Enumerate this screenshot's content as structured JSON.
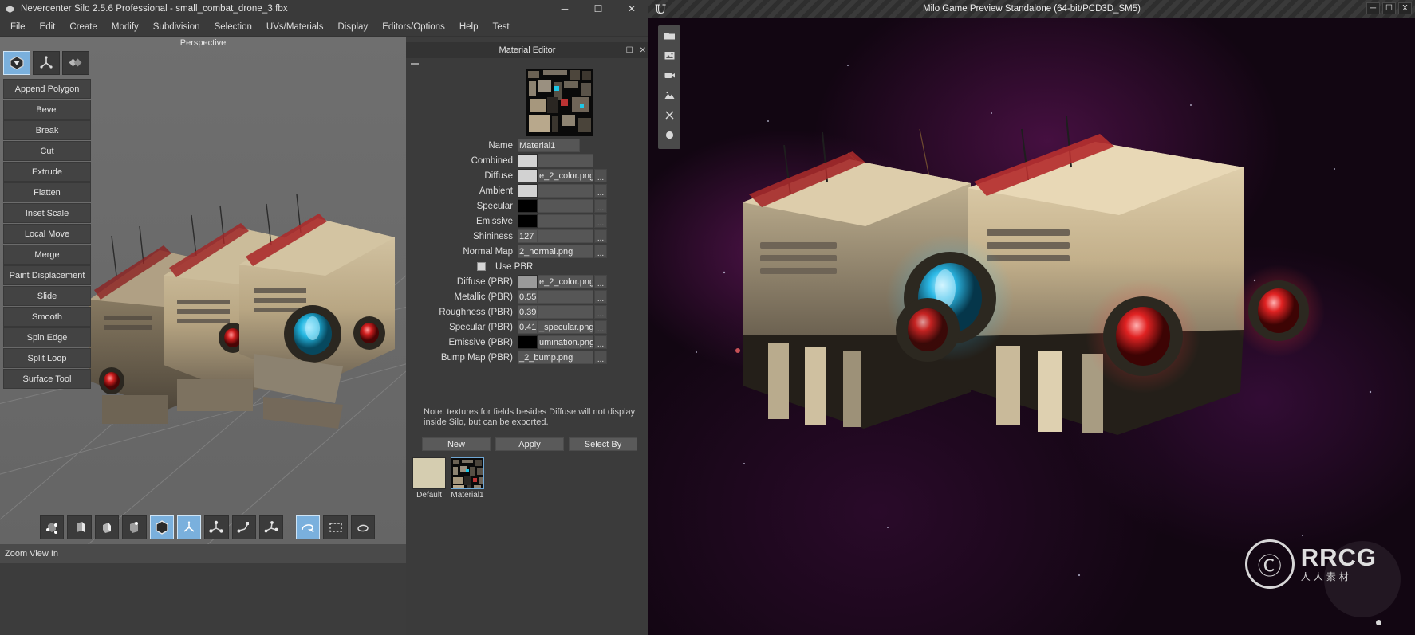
{
  "silo": {
    "title": "Nevercenter Silo 2.5.6 Professional - small_combat_drone_3.fbx",
    "window_icon": "silo-app-icon",
    "window_buttons": {
      "minimize": "─",
      "maximize": "☐",
      "close": "✕"
    },
    "menu": [
      "File",
      "Edit",
      "Create",
      "Modify",
      "Subdivision",
      "Selection",
      "UVs/Materials",
      "Display",
      "Editors/Options",
      "Help",
      "Test"
    ],
    "viewport_label": "Perspective",
    "mode_buttons": [
      {
        "name": "object-mode-icon",
        "active": true
      },
      {
        "name": "manipulator-mode-icon",
        "active": false
      },
      {
        "name": "uv-mode-icon",
        "active": false
      }
    ],
    "tools": [
      "Append Polygon",
      "Bevel",
      "Break",
      "Cut",
      "Extrude",
      "Flatten",
      "Inset Scale",
      "Local Move",
      "Merge",
      "Paint Displacement",
      "Slide",
      "Smooth",
      "Spin Edge",
      "Split Loop",
      "Surface Tool"
    ],
    "selection_bar": [
      {
        "name": "vertex-select-icon",
        "active": false
      },
      {
        "name": "edge-select-icon",
        "active": false
      },
      {
        "name": "face-select-icon",
        "active": false
      },
      {
        "name": "object-select-icon",
        "active": false
      },
      {
        "name": "whole-object-select-icon",
        "active": true
      },
      {
        "name": "move-tool-icon",
        "active": true
      },
      {
        "name": "scale-tool-icon",
        "active": false
      },
      {
        "name": "rotate-tool-icon",
        "active": false
      },
      {
        "name": "universal-tool-icon",
        "active": false
      },
      {
        "name": "lasso-select-icon",
        "active": true
      },
      {
        "name": "rectangle-select-icon",
        "active": false
      },
      {
        "name": "freeform-select-icon",
        "active": false
      }
    ],
    "status_text": "Zoom View In"
  },
  "material_editor": {
    "title": "Material Editor",
    "title_buttons": {
      "maximize": "☐",
      "close": "✕"
    },
    "thumbnail_name": "material-preview-thumbnail",
    "fields": [
      {
        "label": "Name",
        "type": "text",
        "value": "Material1",
        "swatch": null,
        "file": null,
        "browse": false
      },
      {
        "label": "Combined",
        "type": "color",
        "value": null,
        "swatch": "#d4d4d4",
        "file": "",
        "browse": false
      },
      {
        "label": "Diffuse",
        "type": "color",
        "value": null,
        "swatch": "#d2d2d2",
        "file": "e_2_color.png",
        "browse": true
      },
      {
        "label": "Ambient",
        "type": "color",
        "value": null,
        "swatch": "#d2d2d2",
        "file": "",
        "browse": true
      },
      {
        "label": "Specular",
        "type": "color",
        "value": null,
        "swatch": "#000000",
        "file": "",
        "browse": true
      },
      {
        "label": "Emissive",
        "type": "color",
        "value": null,
        "swatch": "#000000",
        "file": "",
        "browse": true
      },
      {
        "label": "Shininess",
        "type": "number",
        "value": "127",
        "swatch": null,
        "file": "",
        "browse": true
      },
      {
        "label": "Normal Map",
        "type": "file",
        "value": null,
        "swatch": null,
        "file": "2_normal.png",
        "browse": true
      }
    ],
    "use_pbr": {
      "label": "Use PBR",
      "checked": false
    },
    "pbr_fields": [
      {
        "label": "Diffuse (PBR)",
        "type": "color",
        "value": null,
        "swatch": "#9a9a9a",
        "file": "e_2_color.png",
        "browse": true
      },
      {
        "label": "Metallic (PBR)",
        "type": "number",
        "value": "0.555",
        "swatch": null,
        "file": "",
        "browse": true
      },
      {
        "label": "Roughness (PBR)",
        "type": "number",
        "value": "0.39",
        "swatch": null,
        "file": "",
        "browse": true
      },
      {
        "label": "Specular (PBR)",
        "type": "number",
        "value": "0.41",
        "swatch": null,
        "file": "_specular.png",
        "browse": true
      },
      {
        "label": "Emissive (PBR)",
        "type": "color",
        "value": null,
        "swatch": "#000000",
        "file": "umination.png",
        "browse": true
      },
      {
        "label": "Bump Map (PBR)",
        "type": "file",
        "value": null,
        "swatch": null,
        "file": "_2_bump.png",
        "browse": true
      }
    ],
    "note": "Note: textures for fields besides Diffuse will not display inside Silo, but can be exported.",
    "buttons": [
      "New",
      "Apply",
      "Select By"
    ],
    "swatches": [
      {
        "label": "Default",
        "color": "#d5cdb0",
        "selected": false
      },
      {
        "label": "Material1",
        "color": "#101010",
        "selected": true
      }
    ]
  },
  "unreal": {
    "title": "Milo Game Preview Standalone (64-bit/PCD3D_SM5)",
    "logo": "unreal-engine-logo-icon",
    "window_buttons": {
      "minimize": "─",
      "maximize": "☐",
      "close": "X"
    },
    "toolbar": [
      {
        "name": "folder-icon"
      },
      {
        "name": "image-icon"
      },
      {
        "name": "video-camera-icon"
      },
      {
        "name": "landscape-icon"
      },
      {
        "name": "resize-icon"
      },
      {
        "name": "sphere-icon"
      }
    ],
    "watermark": {
      "logo": "rrcg-logo-icon",
      "text": "RRCG",
      "subtext": "人人素材"
    }
  }
}
